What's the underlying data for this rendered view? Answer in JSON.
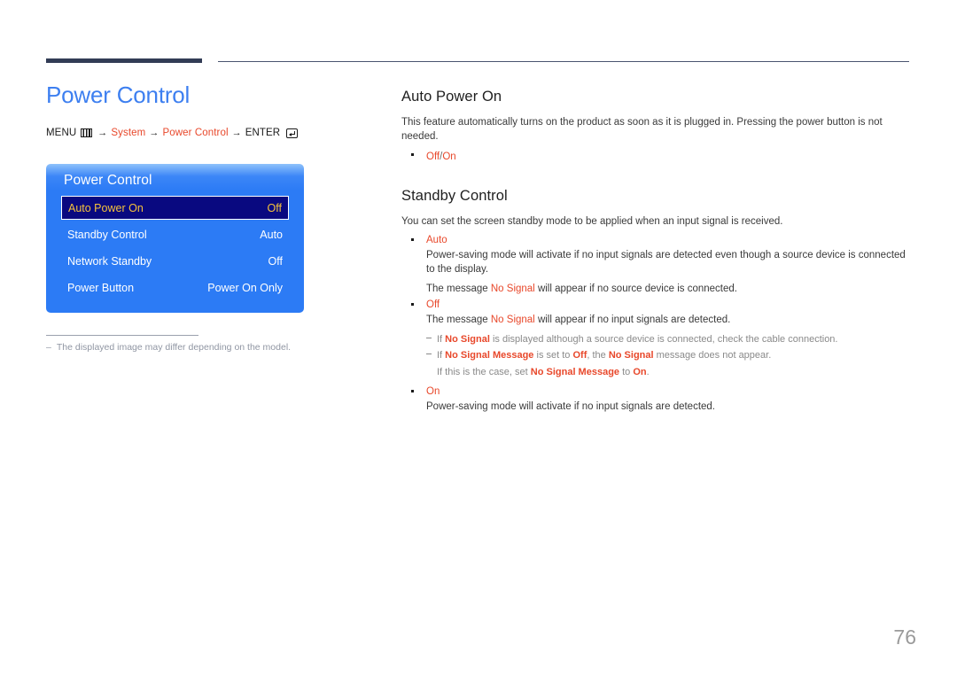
{
  "page": {
    "number": "76"
  },
  "left": {
    "title": "Power Control",
    "menu_path": {
      "menu_label": "MENU",
      "menu_icon": "menu-grid-icon",
      "arrow1": "→",
      "step1": "System",
      "arrow2": "→",
      "step2": "Power Control",
      "arrow3": "→",
      "enter_label": "ENTER",
      "enter_icon": "enter-key-icon"
    },
    "osd": {
      "title": "Power Control",
      "rows": [
        {
          "label": "Auto Power On",
          "value": "Off",
          "selected": true
        },
        {
          "label": "Standby Control",
          "value": "Auto",
          "selected": false
        },
        {
          "label": "Network Standby",
          "value": "Off",
          "selected": false
        },
        {
          "label": "Power Button",
          "value": "Power On Only",
          "selected": false
        }
      ],
      "colors": {
        "header_top": "#8fc2fb",
        "body": "#2c7bf5",
        "selected_bg": "#090980",
        "selected_text": "#f5c23c"
      }
    },
    "footnote": {
      "dash": "–",
      "text": "The displayed image may differ depending on the model."
    }
  },
  "right": {
    "section1": {
      "heading": "Auto Power On",
      "paragraph": "This feature automatically turns on the product as soon as it is plugged in. Pressing the power button is not needed.",
      "option_off": "Off",
      "option_sep": "/",
      "option_on": "On"
    },
    "section2": {
      "heading": "Standby Control",
      "paragraph": "You can set the screen standby mode to be applied when an input signal is received.",
      "items": [
        {
          "label": "Auto",
          "para1": "Power-saving mode will activate if no input signals are detected even though a source device is connected to the display.",
          "para2_pre": "The message ",
          "para2_red": "No Signal",
          "para2_post": " will appear if no source device is connected."
        },
        {
          "label": "Off",
          "para1_pre": "The message ",
          "para1_red": "No Signal",
          "para1_post": " will appear if no input signals are detected.",
          "subnotes": [
            {
              "pre": "If ",
              "red1": "No Signal",
              "mid": " is displayed although a source device is connected, check the cable connection."
            },
            {
              "pre": "If ",
              "red1": "No Signal Message",
              "mid1": " is set to ",
              "red2": "Off",
              "mid2": ", the ",
              "red3": "No Signal",
              "post": " message does not appear.",
              "cont_pre": "If this is the case, set ",
              "cont_red": "No Signal Message",
              "cont_mid": " to ",
              "cont_red2": "On",
              "cont_post": "."
            }
          ]
        },
        {
          "label": "On",
          "para1": "Power-saving mode will activate if no input signals are detected."
        }
      ]
    }
  },
  "colors": {
    "title_blue": "#3d7ff0",
    "accent_red": "#e8482b",
    "rule_dark": "#323c55"
  }
}
